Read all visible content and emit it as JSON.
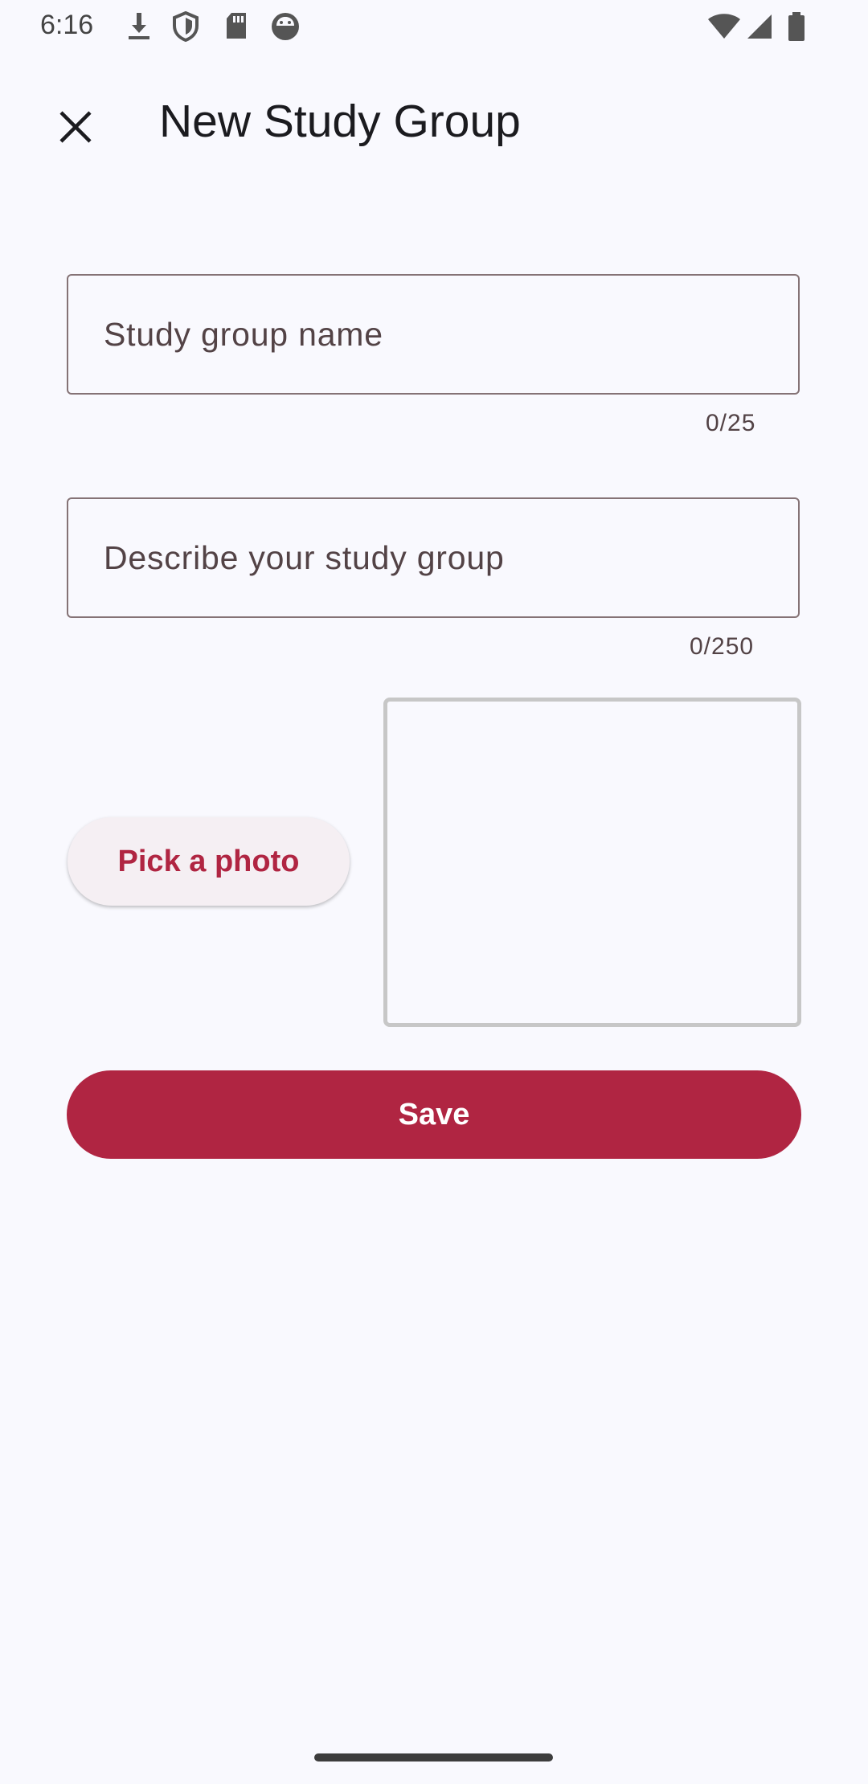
{
  "status_bar": {
    "time": "6:16",
    "left_icons": [
      "download-icon",
      "shield-icon",
      "sd-card-icon",
      "android-face-icon"
    ],
    "right_icons": [
      "wifi-icon",
      "cellular-signal-icon",
      "battery-icon"
    ]
  },
  "app_bar": {
    "close_icon": "close-icon",
    "title": "New Study Group"
  },
  "form": {
    "name_field": {
      "placeholder": "Study group name",
      "value": "",
      "counter": "0/25"
    },
    "description_field": {
      "placeholder": "Describe your study group",
      "value": "",
      "counter": "0/250"
    },
    "pick_photo_label": "Pick a photo",
    "save_label": "Save"
  },
  "colors": {
    "accent": "#b02542",
    "background": "#f9f9fe",
    "outline": "#857376",
    "tonal_button": "#f5eff3"
  }
}
